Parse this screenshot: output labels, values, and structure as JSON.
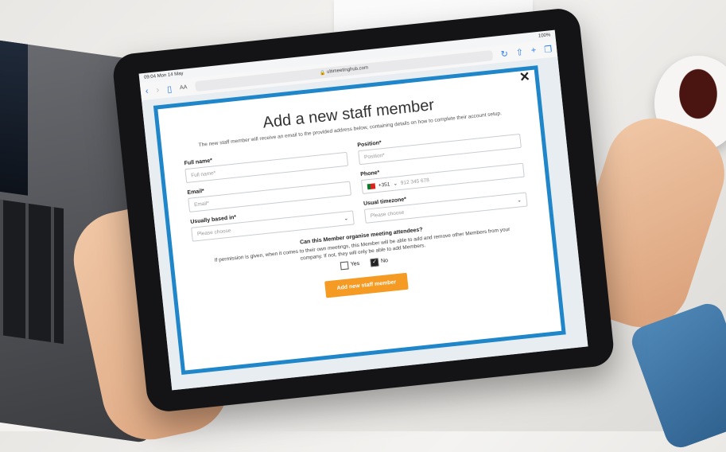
{
  "status_bar": {
    "time": "09:04",
    "date": "Mon 14 May",
    "battery": "100%"
  },
  "browser": {
    "aa_label": "AA",
    "url": "ultimeetinghub.com"
  },
  "modal": {
    "title": "Add a new staff member",
    "subtitle": "The new staff member will receive an email to the provided address below, containing details on how to complete their account setup.",
    "close_icon": "close-icon",
    "fields": {
      "full_name": {
        "label": "Full name*",
        "placeholder": "Full name*"
      },
      "position": {
        "label": "Position*",
        "placeholder": "Position*"
      },
      "email": {
        "label": "Email*",
        "placeholder": "Email*"
      },
      "phone": {
        "label": "Phone*",
        "country_code": "+351",
        "placeholder": "912 345 678"
      },
      "usually_based_in": {
        "label": "Usually based in*",
        "value": "Please choose"
      },
      "usual_timezone": {
        "label": "Usual timezone*",
        "value": "Please choose"
      }
    },
    "question": {
      "title": "Can this Member organise meeting attendees?",
      "text": "If permission is given, when it comes to their own meetings, this Member will be able to add and remove other Members from your company. If not, they will only be able to add Members.",
      "yes_label": "Yes",
      "no_label": "No",
      "selected": "No"
    },
    "submit_label": "Add new staff member",
    "accent_color": "#1f86c9",
    "button_color": "#f59a23"
  }
}
